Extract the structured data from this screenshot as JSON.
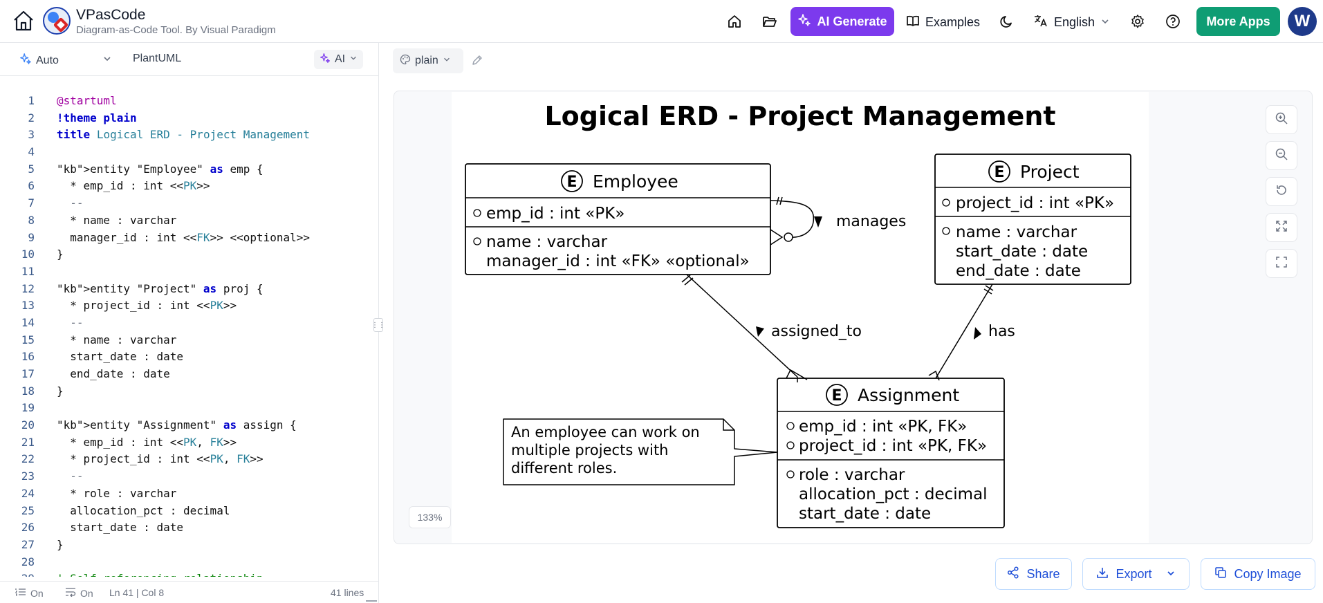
{
  "header": {
    "brand_title": "VPasCode",
    "brand_subtitle": "Diagram-as-Code Tool. By Visual Paradigm",
    "ai_generate_label": "AI Generate",
    "examples_label": "Examples",
    "language_label": "English",
    "more_apps_label": "More Apps",
    "avatar_initial": "W"
  },
  "editor_toolbar": {
    "mode_label": "Auto",
    "language_label": "PlantUML",
    "ai_label": "AI"
  },
  "code": {
    "lines": [
      "@startuml",
      "!theme plain",
      "title Logical ERD - Project Management",
      "",
      "entity \"Employee\" as emp {",
      "  * emp_id : int <<PK>>",
      "  --",
      "  * name : varchar",
      "  manager_id : int <<FK>> <<optional>>",
      "}",
      "",
      "entity \"Project\" as proj {",
      "  * project_id : int <<PK>>",
      "  --",
      "  * name : varchar",
      "  start_date : date",
      "  end_date : date",
      "}",
      "",
      "entity \"Assignment\" as assign {",
      "  * emp_id : int <<PK, FK>>",
      "  * project_id : int <<PK, FK>>",
      "  --",
      "  * role : varchar",
      "  allocation_pct : decimal",
      "  start_date : date",
      "}",
      "",
      "' Self-referencing relationship"
    ]
  },
  "statusbar": {
    "toggle1_label": "On",
    "toggle2_label": "On",
    "cursor_label": "Ln 41 | Col 8",
    "lines_label": "41 lines"
  },
  "preview_toolbar": {
    "theme_label": "plain"
  },
  "diagram": {
    "title": "Logical ERD - Project Management",
    "employee": {
      "name": "Employee",
      "pk": "emp_id : int «PK»",
      "attr1": "name : varchar",
      "attr2": "manager_id : int «FK» «optional»"
    },
    "project": {
      "name": "Project",
      "pk": "project_id : int «PK»",
      "attr1": "name : varchar",
      "attr2": "start_date : date",
      "attr3": "end_date : date"
    },
    "assignment": {
      "name": "Assignment",
      "pk1": "emp_id : int «PK, FK»",
      "pk2": "project_id : int «PK, FK»",
      "attr1": "role : varchar",
      "attr2": "allocation_pct : decimal",
      "attr3": "start_date : date"
    },
    "rel_manages": "manages",
    "rel_assigned": "assigned_to",
    "rel_has": "has",
    "note_line1": "An employee can work on",
    "note_line2": "multiple projects with",
    "note_line3": "different roles.",
    "entity_glyph": "E"
  },
  "zoom_label": "133%",
  "actions": {
    "share_label": "Share",
    "export_label": "Export",
    "copy_label": "Copy Image"
  }
}
